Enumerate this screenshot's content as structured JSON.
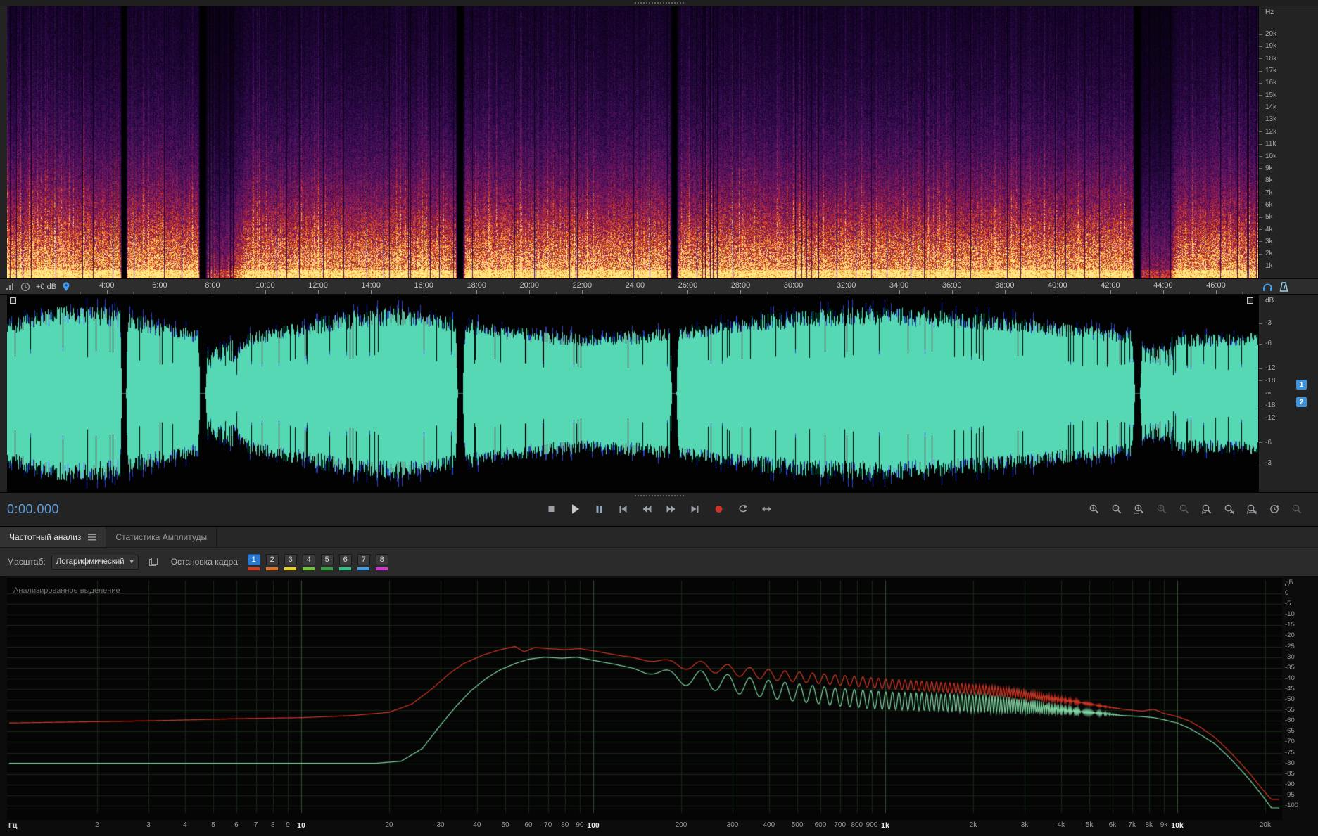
{
  "spectral": {
    "unit": "Hz",
    "freq_labels": [
      "20k",
      "19k",
      "18k",
      "17k",
      "16k",
      "15k",
      "14k",
      "13k",
      "12k",
      "11k",
      "10k",
      "9k",
      "8k",
      "7k",
      "6k",
      "5k",
      "4k",
      "3k",
      "2k",
      "1k"
    ],
    "colormap": [
      [
        0,
        "#000000"
      ],
      [
        0.14,
        "#1a0433"
      ],
      [
        0.3,
        "#47105f"
      ],
      [
        0.45,
        "#77175f"
      ],
      [
        0.58,
        "#a81f48"
      ],
      [
        0.7,
        "#d53a20"
      ],
      [
        0.83,
        "#f07c1a"
      ],
      [
        0.93,
        "#ffbb38"
      ],
      [
        1,
        "#ffe98a"
      ]
    ]
  },
  "timeline": {
    "gain_readout": "+0 dB",
    "start_min": 0.22,
    "end_min": 47.6,
    "labels": [
      "4:00",
      "6:00",
      "8:00",
      "10:00",
      "12:00",
      "14:00",
      "16:00",
      "18:00",
      "20:00",
      "22:00",
      "24:00",
      "26:00",
      "28:00",
      "30:00",
      "32:00",
      "34:00",
      "36:00",
      "38:00",
      "40:00",
      "42:00",
      "44:00",
      "46:00"
    ],
    "first_label_min": 4,
    "label_step_min": 2
  },
  "audio": {
    "wave_color": "#57d8b5",
    "wave_alt_color": "#2a3ecf",
    "envelope": [
      [
        0.22,
        0.95
      ],
      [
        4.5,
        0.95
      ],
      [
        4.56,
        0
      ],
      [
        4.72,
        0
      ],
      [
        4.78,
        0.95
      ],
      [
        7.45,
        0.95
      ],
      [
        7.52,
        0
      ],
      [
        7.72,
        0
      ],
      [
        7.8,
        0.45
      ],
      [
        8.6,
        0.52
      ],
      [
        9.4,
        0.92
      ],
      [
        17.18,
        0.92
      ],
      [
        17.28,
        0
      ],
      [
        17.46,
        0
      ],
      [
        17.56,
        0.93
      ],
      [
        25.3,
        0.93
      ],
      [
        25.4,
        0
      ],
      [
        25.56,
        0
      ],
      [
        25.66,
        0.93
      ],
      [
        42.82,
        0.93
      ],
      [
        42.92,
        0
      ],
      [
        43.1,
        0
      ],
      [
        43.2,
        0.48
      ],
      [
        44.25,
        0.48
      ],
      [
        44.55,
        0.92
      ],
      [
        47.6,
        0.9
      ]
    ]
  },
  "wave_scale": {
    "unit": "dB",
    "db_ticks": [
      "-3",
      "-6",
      "-12",
      "-18"
    ],
    "infinity": "-∞",
    "channels": [
      "1",
      "2"
    ]
  },
  "transport": {
    "time_display": "0:00.000",
    "buttons": [
      {
        "name": "stop"
      },
      {
        "name": "play"
      },
      {
        "name": "pause"
      },
      {
        "name": "skip-to-start"
      },
      {
        "name": "rewind"
      },
      {
        "name": "fast-forward"
      },
      {
        "name": "skip-to-end"
      },
      {
        "name": "record"
      },
      {
        "name": "loop-playback"
      },
      {
        "name": "skip-selection"
      }
    ],
    "zoom_buttons": [
      {
        "name": "zoom-in",
        "dim": false
      },
      {
        "name": "zoom-out",
        "dim": false
      },
      {
        "name": "zoom-selection",
        "dim": false
      },
      {
        "name": "zoom-in-amplitude",
        "dim": true
      },
      {
        "name": "zoom-out-amplitude",
        "dim": true
      },
      {
        "name": "zoom-selection-left",
        "dim": false
      },
      {
        "name": "zoom-selection-right",
        "dim": false
      },
      {
        "name": "zoom-full-selection",
        "dim": false
      },
      {
        "name": "zoom-reset",
        "dim": false
      },
      {
        "name": "zoom-out-full",
        "dim": true
      }
    ]
  },
  "tabs": [
    {
      "label": "Частотный анализ",
      "active": true
    },
    {
      "label": "Статистика Амплитуды",
      "active": false
    }
  ],
  "controls": {
    "scale_label": "Масштаб:",
    "scale_value": "Логарифмический",
    "chevron": "▾",
    "hold_label": "Остановка кадра:",
    "holds": [
      {
        "label": "1",
        "color": "#d83923",
        "selected": true
      },
      {
        "label": "2",
        "color": "#e2711d",
        "selected": false
      },
      {
        "label": "3",
        "color": "#ead21c",
        "selected": false
      },
      {
        "label": "4",
        "color": "#6cc832",
        "selected": false
      },
      {
        "label": "5",
        "color": "#2fa33b",
        "selected": false
      },
      {
        "label": "6",
        "color": "#2cc489",
        "selected": false
      },
      {
        "label": "7",
        "color": "#3f9de8",
        "selected": false
      },
      {
        "label": "8",
        "color": "#d633d6",
        "selected": false
      }
    ]
  },
  "chart": {
    "overlay_text": "Анализированное выделение",
    "y_unit": "дБ",
    "x_unit": "Гц"
  },
  "chart_data": {
    "type": "line",
    "title": "Частотный анализ",
    "x_scale": "log",
    "x_range_hz": [
      1,
      22500
    ],
    "y_range_db": [
      -100,
      0
    ],
    "grid": true,
    "grid_color": "#152815",
    "grid_major_color": "#2b522b",
    "y_tick_step_db": 5,
    "y_tick_labels": [
      "0",
      "-5",
      "-10",
      "-15",
      "-20",
      "-25",
      "-30",
      "-35",
      "-40",
      "-45",
      "-50",
      "-55",
      "-60",
      "-65",
      "-70",
      "-75",
      "-80",
      "-85",
      "-90",
      "-95",
      "-100"
    ],
    "x_ticks": [
      {
        "f": 2,
        "label": "2"
      },
      {
        "f": 3,
        "label": "3"
      },
      {
        "f": 4,
        "label": "4"
      },
      {
        "f": 5,
        "label": "5"
      },
      {
        "f": 6,
        "label": "6"
      },
      {
        "f": 7,
        "label": "7"
      },
      {
        "f": 8,
        "label": "8"
      },
      {
        "f": 9,
        "label": "9"
      },
      {
        "f": 10,
        "label": "10",
        "major": true
      },
      {
        "f": 20,
        "label": "20"
      },
      {
        "f": 30,
        "label": "30"
      },
      {
        "f": 40,
        "label": "40"
      },
      {
        "f": 50,
        "label": "50"
      },
      {
        "f": 60,
        "label": "60"
      },
      {
        "f": 70,
        "label": "70"
      },
      {
        "f": 80,
        "label": "80"
      },
      {
        "f": 90,
        "label": "90"
      },
      {
        "f": 100,
        "label": "100",
        "major": true
      },
      {
        "f": 200,
        "label": "200"
      },
      {
        "f": 300,
        "label": "300"
      },
      {
        "f": 400,
        "label": "400"
      },
      {
        "f": 500,
        "label": "500"
      },
      {
        "f": 600,
        "label": "600"
      },
      {
        "f": 700,
        "label": "700"
      },
      {
        "f": 800,
        "label": "800"
      },
      {
        "f": 900,
        "label": "900"
      },
      {
        "f": 1000,
        "label": "1k",
        "major": true
      },
      {
        "f": 2000,
        "label": "2k"
      },
      {
        "f": 3000,
        "label": "3k"
      },
      {
        "f": 4000,
        "label": "4k"
      },
      {
        "f": 5000,
        "label": "5k"
      },
      {
        "f": 6000,
        "label": "6k"
      },
      {
        "f": 7000,
        "label": "7k"
      },
      {
        "f": 8000,
        "label": "8k"
      },
      {
        "f": 9000,
        "label": "9k"
      },
      {
        "f": 10000,
        "label": "10k",
        "major": true
      },
      {
        "f": 20000,
        "label": "20k"
      }
    ],
    "ripple": {
      "f0_hz": 55,
      "start_hz": 130,
      "full_hz": 220,
      "fade_hz": 2400,
      "end_hz": 6500
    },
    "series": [
      {
        "name": "channel-1",
        "color": "#d23523",
        "ripple_amp_db": 2.4,
        "points": [
          [
            1,
            -61
          ],
          [
            3,
            -60
          ],
          [
            6,
            -59
          ],
          [
            10,
            -58.5
          ],
          [
            15,
            -57.5
          ],
          [
            20,
            -56
          ],
          [
            24,
            -52
          ],
          [
            28,
            -45
          ],
          [
            32,
            -38
          ],
          [
            36,
            -33
          ],
          [
            42,
            -29
          ],
          [
            48,
            -26.5
          ],
          [
            54,
            -25
          ],
          [
            58,
            -27.5
          ],
          [
            63,
            -25.5
          ],
          [
            70,
            -26
          ],
          [
            80,
            -26.5
          ],
          [
            90,
            -26
          ],
          [
            100,
            -27
          ],
          [
            120,
            -29
          ],
          [
            150,
            -31
          ],
          [
            200,
            -33.5
          ],
          [
            260,
            -35
          ],
          [
            330,
            -37
          ],
          [
            420,
            -38.5
          ],
          [
            520,
            -39.5
          ],
          [
            650,
            -40.5
          ],
          [
            800,
            -41.5
          ],
          [
            1000,
            -42.5
          ],
          [
            1300,
            -43.5
          ],
          [
            1700,
            -44.5
          ],
          [
            2200,
            -45.5
          ],
          [
            2800,
            -47
          ],
          [
            3500,
            -49
          ],
          [
            4500,
            -51
          ],
          [
            5500,
            -53
          ],
          [
            6500,
            -54.5
          ],
          [
            7600,
            -55.5
          ],
          [
            8300,
            -54.5
          ],
          [
            9000,
            -56.5
          ],
          [
            10000,
            -58
          ],
          [
            11000,
            -60
          ],
          [
            12000,
            -63
          ],
          [
            13500,
            -68
          ],
          [
            15000,
            -74
          ],
          [
            16500,
            -80
          ],
          [
            18000,
            -86
          ],
          [
            19500,
            -92
          ],
          [
            21000,
            -97
          ]
        ]
      },
      {
        "name": "channel-2",
        "color": "#7fd6a2",
        "ripple_amp_db": 4.2,
        "points": [
          [
            1,
            -80
          ],
          [
            18,
            -80
          ],
          [
            22,
            -79
          ],
          [
            26,
            -73
          ],
          [
            30,
            -62
          ],
          [
            34,
            -53
          ],
          [
            38,
            -46
          ],
          [
            43,
            -40
          ],
          [
            48,
            -36
          ],
          [
            54,
            -33
          ],
          [
            60,
            -31
          ],
          [
            68,
            -30
          ],
          [
            78,
            -30.5
          ],
          [
            88,
            -30
          ],
          [
            100,
            -31.5
          ],
          [
            120,
            -33.5
          ],
          [
            150,
            -36.5
          ],
          [
            200,
            -39.5
          ],
          [
            260,
            -41.5
          ],
          [
            330,
            -43.5
          ],
          [
            420,
            -45.5
          ],
          [
            520,
            -47
          ],
          [
            650,
            -48.5
          ],
          [
            800,
            -49.5
          ],
          [
            1000,
            -50.5
          ],
          [
            1300,
            -51
          ],
          [
            1700,
            -51.5
          ],
          [
            2200,
            -52
          ],
          [
            2800,
            -53
          ],
          [
            3500,
            -54
          ],
          [
            4500,
            -55.5
          ],
          [
            5500,
            -56.5
          ],
          [
            6500,
            -57.5
          ],
          [
            7600,
            -58
          ],
          [
            8300,
            -58.5
          ],
          [
            9000,
            -59.5
          ],
          [
            10000,
            -61
          ],
          [
            11000,
            -63.5
          ],
          [
            12000,
            -66.5
          ],
          [
            13500,
            -71
          ],
          [
            15000,
            -77
          ],
          [
            16500,
            -83
          ],
          [
            18000,
            -89
          ],
          [
            19500,
            -95
          ],
          [
            21000,
            -101
          ]
        ]
      }
    ]
  },
  "icon_names": [
    "level-meter-icon",
    "clock-icon",
    "pin-icon",
    "monitor-headphones-icon",
    "metronome-icon",
    "panel-menu-icon",
    "copy-data-icon",
    "chevron-down-icon",
    "grip-handle",
    "fade-handle",
    "stop-icon",
    "play-icon",
    "pause-icon",
    "skip-to-start-icon",
    "rewind-icon",
    "fast-forward-icon",
    "skip-to-end-icon",
    "record-icon",
    "loop-playback-icon",
    "skip-selection-icon",
    "zoom-in-icon",
    "zoom-out-icon",
    "zoom-selection-icon",
    "zoom-in-amplitude-icon",
    "zoom-out-amplitude-icon",
    "zoom-selection-left-icon",
    "zoom-selection-right-icon",
    "zoom-full-selection-icon",
    "zoom-reset-icon",
    "zoom-out-full-icon"
  ]
}
